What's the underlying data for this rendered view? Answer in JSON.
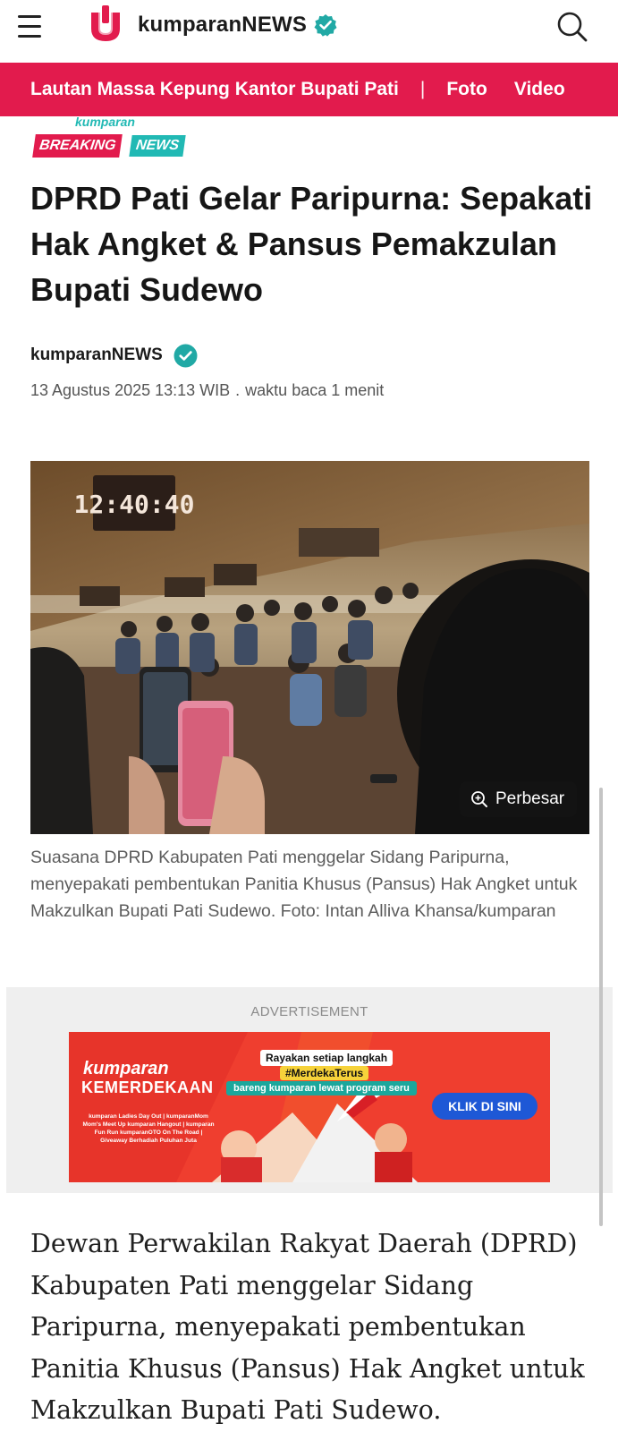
{
  "header": {
    "brand_name": "kumparanNEWS",
    "menu_icon": "hamburger-menu-icon",
    "search_icon": "search-icon",
    "verified_icon": "verified-check-icon"
  },
  "nav_strip": {
    "headline_link": "Lautan Massa Kepung Kantor Bupati Pati",
    "separator": "|",
    "foto": "Foto",
    "video": "Video",
    "background_color": "#e21b4d"
  },
  "badge": {
    "kumparan": "kumparan",
    "breaking": "BREAKING",
    "news": "NEWS"
  },
  "article": {
    "title": "DPRD Pati Gelar Paripurna: Sepakati Hak Angket & Pansus Pemakzulan Bupati Sudewo",
    "author": "kumparanNEWS",
    "date": "13 Agustus 2025 13:13 WIB",
    "dot": ".",
    "read_time": "waktu baca 1 menit",
    "photo": {
      "clock_text": "12:40:40",
      "enlarge_label": "Perbesar"
    },
    "caption": "Suasana DPRD Kabupaten Pati menggelar Sidang Paripurna, menyepakati pembentukan Panitia Khusus (Pansus) Hak Angket untuk Makzulkan Bupati Pati Sudewo. Foto: Intan Alliva Khansa/kumparan",
    "body": "Dewan Perwakilan Rakyat Daerah (DPRD) Kabupaten Pati menggelar Sidang Paripurna, menyepakati pembentukan Panitia Khusus (Pansus) Hak Angket untuk Makzulkan Bupati Pati Sudewo."
  },
  "ad": {
    "label": "ADVERTISEMENT",
    "brand_top": "kumparan",
    "brand_bottom": "KEMERDEKAAN",
    "tagline_1": "Rayakan setiap langkah",
    "tagline_2": "#MerdekaTerus",
    "tagline_3": "bareng kumparan lewat program seru",
    "events": "kumparan Ladies Day Out | kumparanMom Mom's Meet Up kumparan Hangout | kumparan Fun Run kumparanOTO On The Road | Giveaway Berhadiah Puluhan Juta",
    "cta": "KLIK DI SINI"
  }
}
